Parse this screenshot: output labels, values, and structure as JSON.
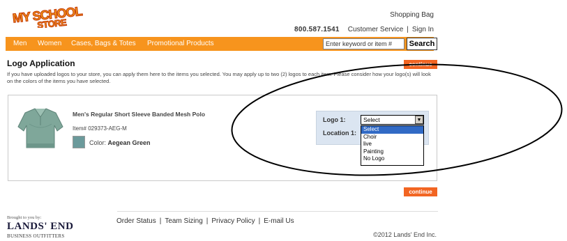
{
  "header": {
    "logo_text": "MY SCHOOL STORE",
    "shopping_bag": "Shopping Bag",
    "phone": "800.587.1541",
    "customer_service": "Customer Service",
    "separator": "|",
    "sign_in": "Sign In"
  },
  "nav": {
    "items": [
      "Men",
      "Women",
      "Cases, Bags & Totes",
      "Promotional Products"
    ],
    "search_placeholder": "Enter keyword or item #",
    "search_button": "Search"
  },
  "main": {
    "title": "Logo Application",
    "continue_label": "continue",
    "description": "If you have uploaded logos to your store, you can apply them here to the items you selected. You may apply up to two (2) logos to each item. Please consider how your logo(s) will look on the colors of the items you have selected."
  },
  "product": {
    "name": "Men's Regular Short Sleeve Banded Mesh Polo",
    "item_number": "Item# 029373-AEG-M",
    "color_label": "Color:",
    "color_value": "Aegean Green",
    "swatch_color": "#6b9a9b"
  },
  "logo_options": {
    "logo1_label": "Logo 1:",
    "location1_label": "Location 1:",
    "selected": "Select",
    "options": [
      "Select",
      "Choir",
      "live",
      "Painting",
      "No Logo"
    ]
  },
  "footer": {
    "brought_to_you": "Brought to you by:",
    "brand": "LANDS' END",
    "brand_sub": "BUSINESS OUTFITTERS",
    "links": [
      "Order Status",
      "Team Sizing",
      "Privacy Policy",
      "E-mail Us"
    ],
    "copyright": "©2012 Lands' End Inc."
  },
  "colors": {
    "accent_orange": "#f7941d",
    "button_orange": "#f26522",
    "selection_blue": "#316ac5",
    "logo_panel_bg": "#dbe5f1"
  }
}
